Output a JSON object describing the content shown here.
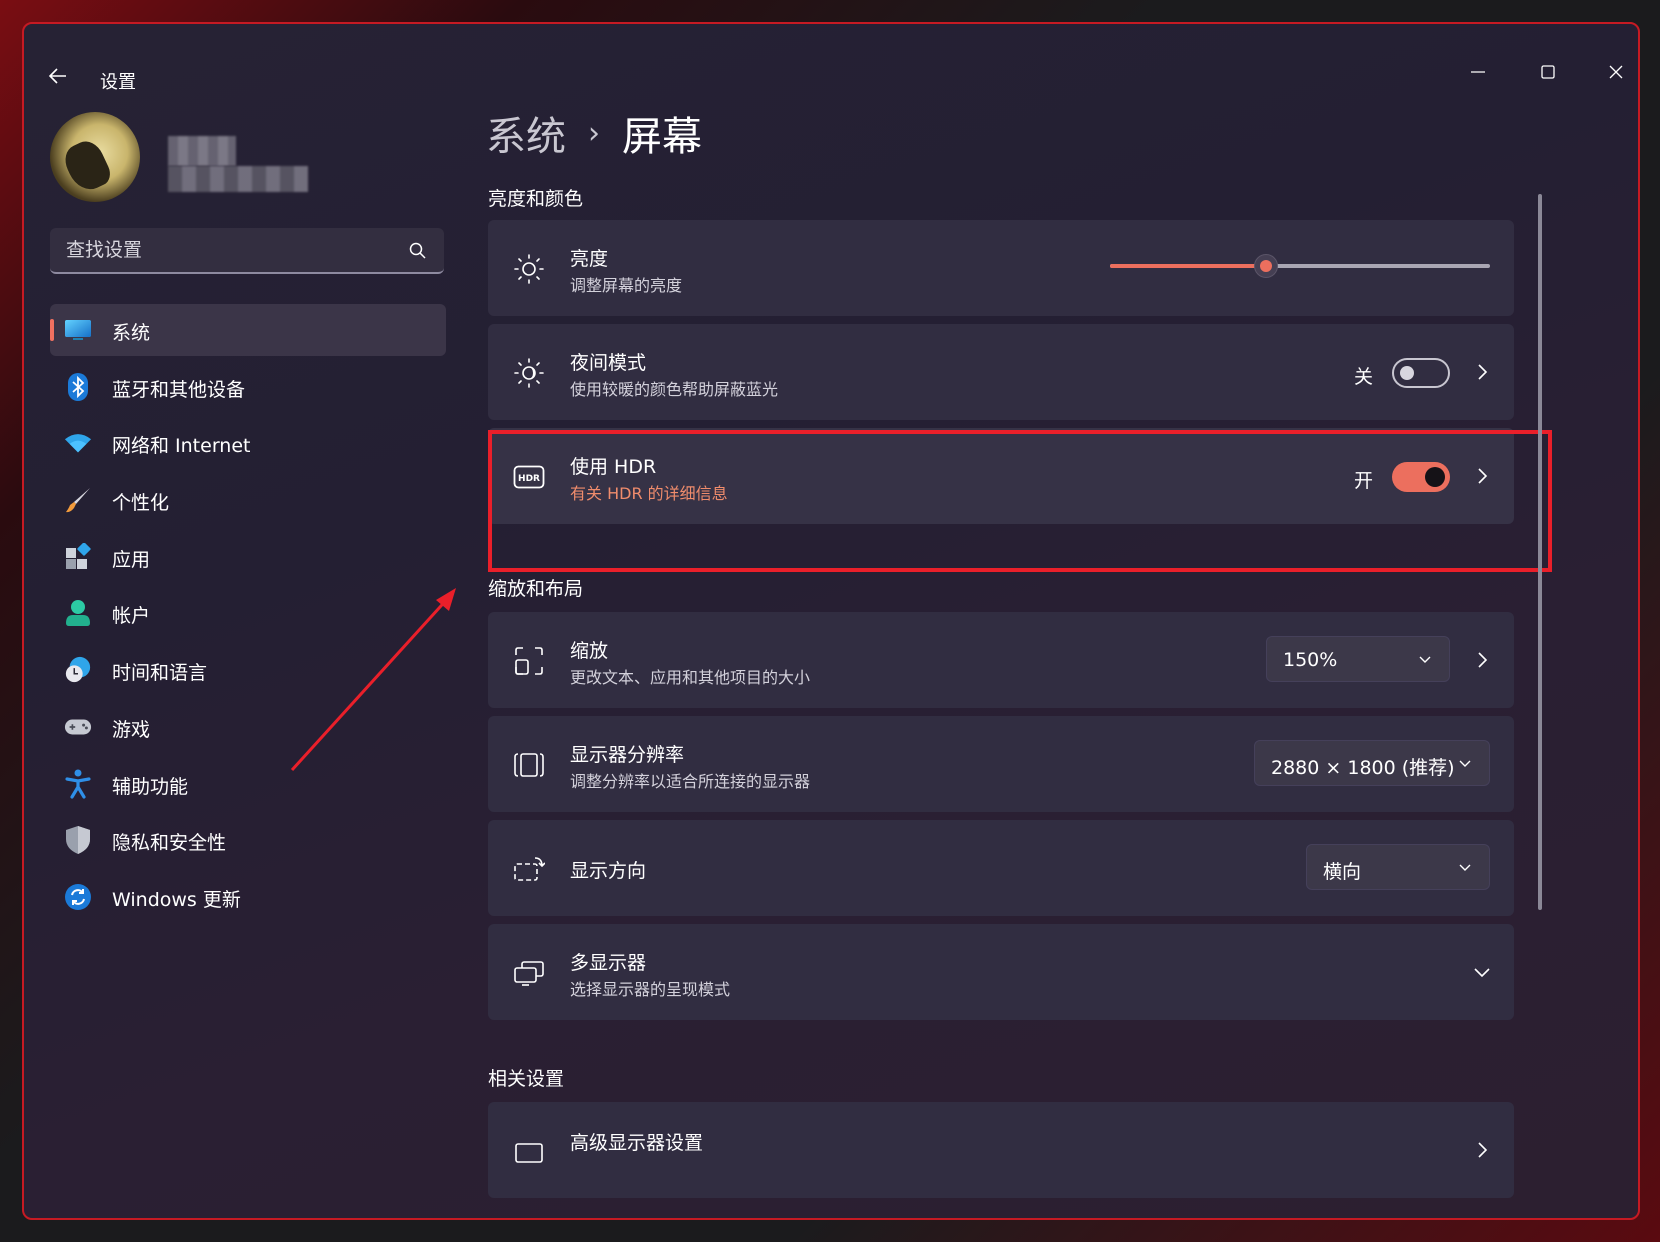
{
  "window": {
    "app_title": "设置",
    "controls": {
      "minimize": "minimize-icon",
      "maximize": "maximize-icon",
      "close": "close-icon"
    }
  },
  "profile": {
    "name": "",
    "email": ""
  },
  "search": {
    "placeholder": "查找设置"
  },
  "nav": {
    "items": [
      {
        "label": "系统",
        "icon": "system-display-icon",
        "active": true
      },
      {
        "label": "蓝牙和其他设备",
        "icon": "bluetooth-icon"
      },
      {
        "label": "网络和 Internet",
        "icon": "wifi-icon"
      },
      {
        "label": "个性化",
        "icon": "paintbrush-icon"
      },
      {
        "label": "应用",
        "icon": "apps-icon"
      },
      {
        "label": "帐户",
        "icon": "account-icon"
      },
      {
        "label": "时间和语言",
        "icon": "time-language-icon"
      },
      {
        "label": "游戏",
        "icon": "gamepad-icon"
      },
      {
        "label": "辅助功能",
        "icon": "accessibility-icon"
      },
      {
        "label": "隐私和安全性",
        "icon": "shield-icon"
      },
      {
        "label": "Windows 更新",
        "icon": "windows-update-icon"
      }
    ]
  },
  "breadcrumb": {
    "parent": "系统",
    "separator": "›",
    "current": "屏幕"
  },
  "sections": {
    "brightness_color": "亮度和颜色",
    "scale_layout": "缩放和布局",
    "related": "相关设置"
  },
  "brightness": {
    "title": "亮度",
    "subtitle": "调整屏幕的亮度",
    "value_fraction": 0.41
  },
  "night_mode": {
    "title": "夜间模式",
    "subtitle": "使用较暖的颜色帮助屏蔽蓝光",
    "state_label": "关",
    "on": false
  },
  "hdr": {
    "title": "使用 HDR",
    "subtitle": "有关 HDR 的详细信息",
    "state_label": "开",
    "on": true
  },
  "scale": {
    "title": "缩放",
    "subtitle": "更改文本、应用和其他项目的大小",
    "value": "150%"
  },
  "resolution": {
    "title": "显示器分辨率",
    "subtitle": "调整分辨率以适合所连接的显示器",
    "value": "2880 × 1800 (推荐)"
  },
  "orientation": {
    "title": "显示方向",
    "value": "横向"
  },
  "multi_display": {
    "title": "多显示器",
    "subtitle": "选择显示器的呈现模式"
  },
  "advanced_display": {
    "title": "高级显示器设置"
  },
  "colors": {
    "accent": "#ec6f5e",
    "highlight_annotation": "#ea1f2a"
  }
}
